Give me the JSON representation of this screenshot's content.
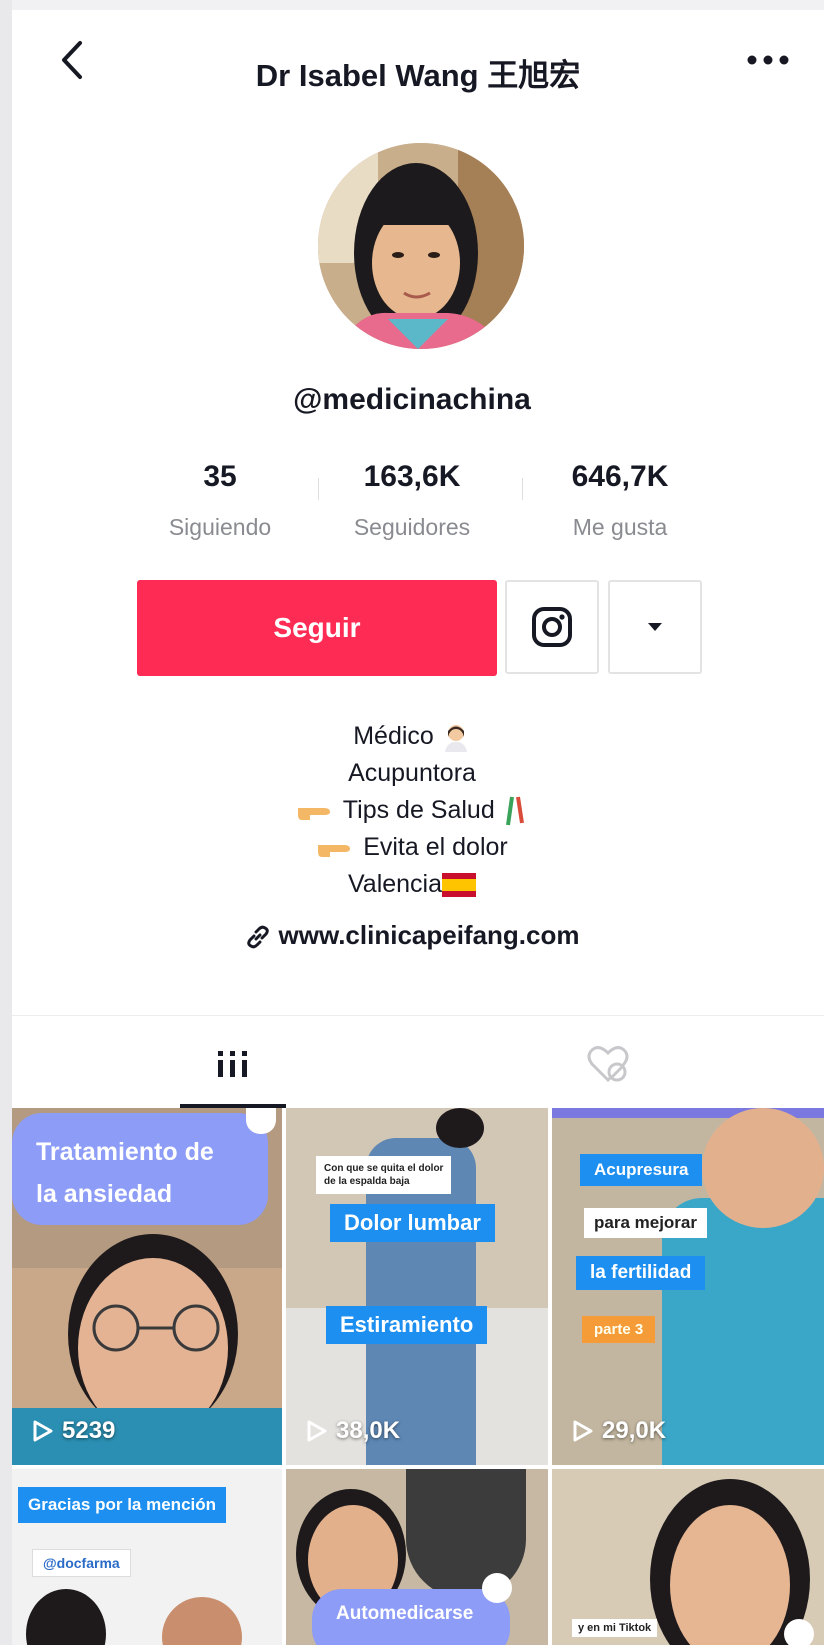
{
  "header": {
    "title": "Dr Isabel Wang 王旭宏"
  },
  "profile": {
    "username": "@medicinachina",
    "stats": [
      {
        "value": "35",
        "label": "Siguiendo"
      },
      {
        "value": "163,6K",
        "label": "Seguidores"
      },
      {
        "value": "646,7K",
        "label": "Me gusta"
      }
    ],
    "follow_label": "Seguir",
    "bio": [
      "Médico",
      "Acupuntora",
      "Tips de Salud",
      "Evita el dolor",
      "Valencia"
    ],
    "website": "www.clinicapeifang.com"
  },
  "colors": {
    "accent": "#fe2c55",
    "text": "#161823",
    "muted": "#8a8b91",
    "label_blue": "#1c8ff0",
    "bubble_purple": "#8d9cf6"
  },
  "icons": [
    "chevron-left-icon",
    "more-horizontal-icon",
    "instagram-icon",
    "caret-down-icon",
    "link-icon",
    "grid-icon",
    "liked-videos-icon",
    "play-icon",
    "tiktok-logo-icon"
  ],
  "videos": [
    {
      "overlay": [
        "Tratamiento de",
        "la ansiedad"
      ],
      "views": "5239"
    },
    {
      "overlay": [
        "Con que se quita el dolor",
        "de la espalda baja",
        "Dolor lumbar",
        "Estiramiento"
      ],
      "views": "38,0K"
    },
    {
      "overlay": [
        "Acupresura",
        "para mejorar",
        "la fertilidad",
        "parte 3"
      ],
      "views": "29,0K"
    },
    {
      "overlay": [
        "Gracias por la mención",
        "@docfarma"
      ],
      "views": ""
    },
    {
      "overlay": [
        "Automedicarse"
      ],
      "views": ""
    },
    {
      "overlay": [
        "y en mi Tiktok"
      ],
      "views": ""
    }
  ]
}
